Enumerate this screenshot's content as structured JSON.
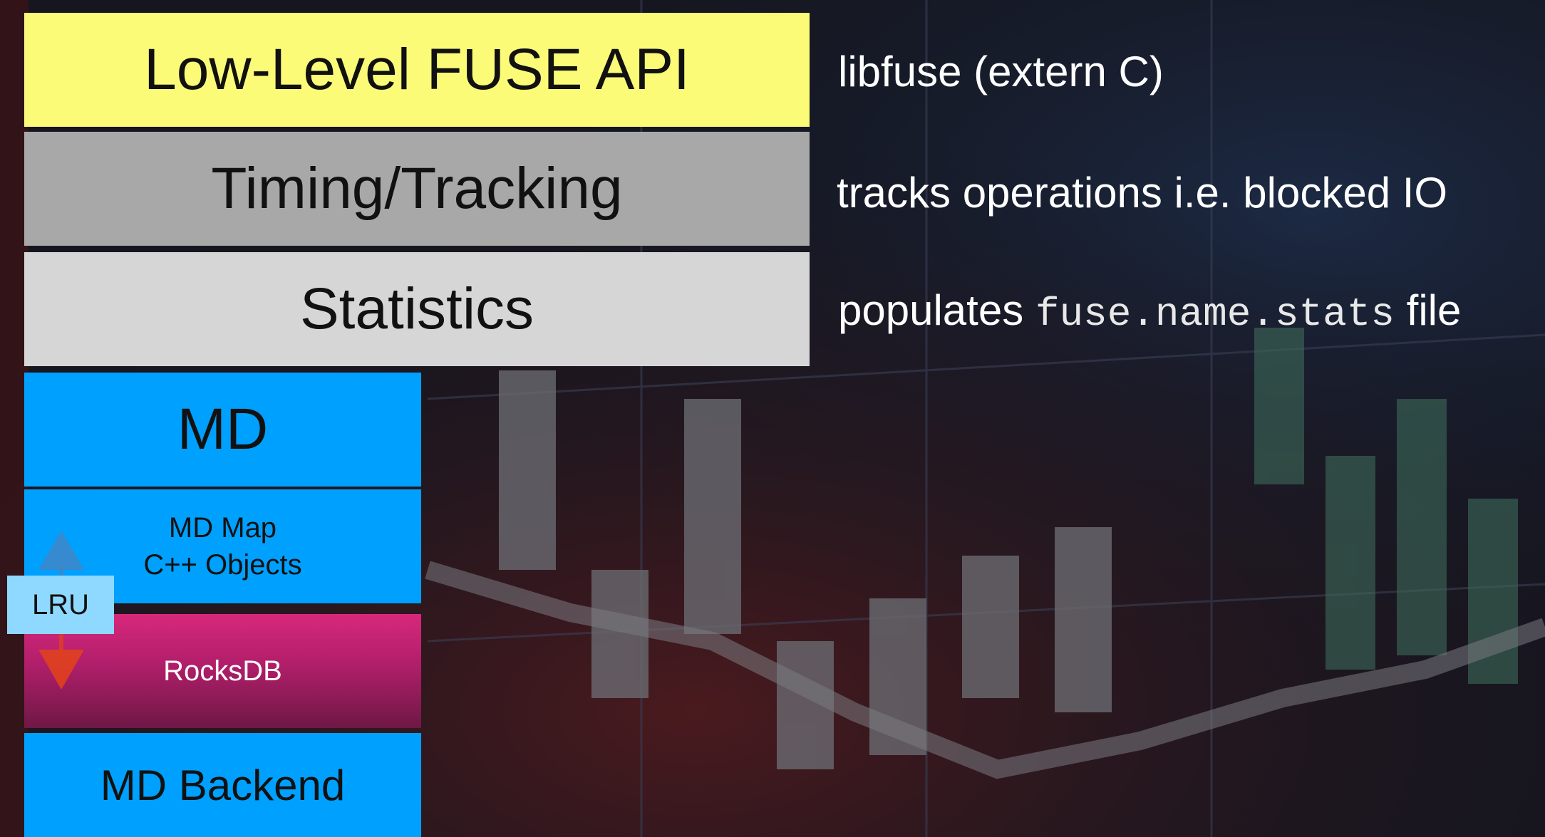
{
  "layers": {
    "fuse_api": "Low-Level FUSE API",
    "timing": "Timing/Tracking",
    "statistics": "Statistics",
    "md": "MD",
    "md_map_line1": "MD Map",
    "md_map_line2": "C++ Objects",
    "rocksdb": "RocksDB",
    "md_backend": "MD Backend",
    "lru": "LRU"
  },
  "annotations": {
    "fuse_api": "libfuse (extern C)",
    "timing": "tracks operations i.e. blocked IO",
    "stats_prefix": "populates ",
    "stats_file": "fuse.name.stats",
    "stats_suffix": " file"
  },
  "colors": {
    "fuse_api": "#fcfb78",
    "timing": "#a8a8a8",
    "statistics": "#d6d6d6",
    "md_blue": "#00a0ff",
    "rocksdb": "#c02273",
    "lru": "#8fd8ff",
    "arrow_up": "#3f86c8",
    "arrow_down": "#e0401e"
  }
}
